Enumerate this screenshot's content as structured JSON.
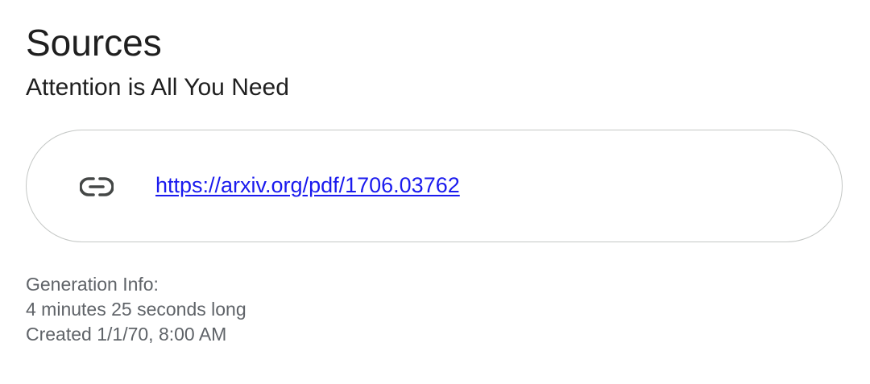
{
  "page_title": "Sources",
  "source": {
    "title": "Attention is All You Need",
    "icon": "link-icon",
    "url": "https://arxiv.org/pdf/1706.03762"
  },
  "generation_info": {
    "heading": "Generation Info:",
    "duration": "4 minutes 25 seconds long",
    "created": "Created 1/1/70, 8:00 AM"
  },
  "colors": {
    "link": "#1a1aee",
    "secondary_text": "#5f6368",
    "card_border": "#c4c7c5"
  }
}
